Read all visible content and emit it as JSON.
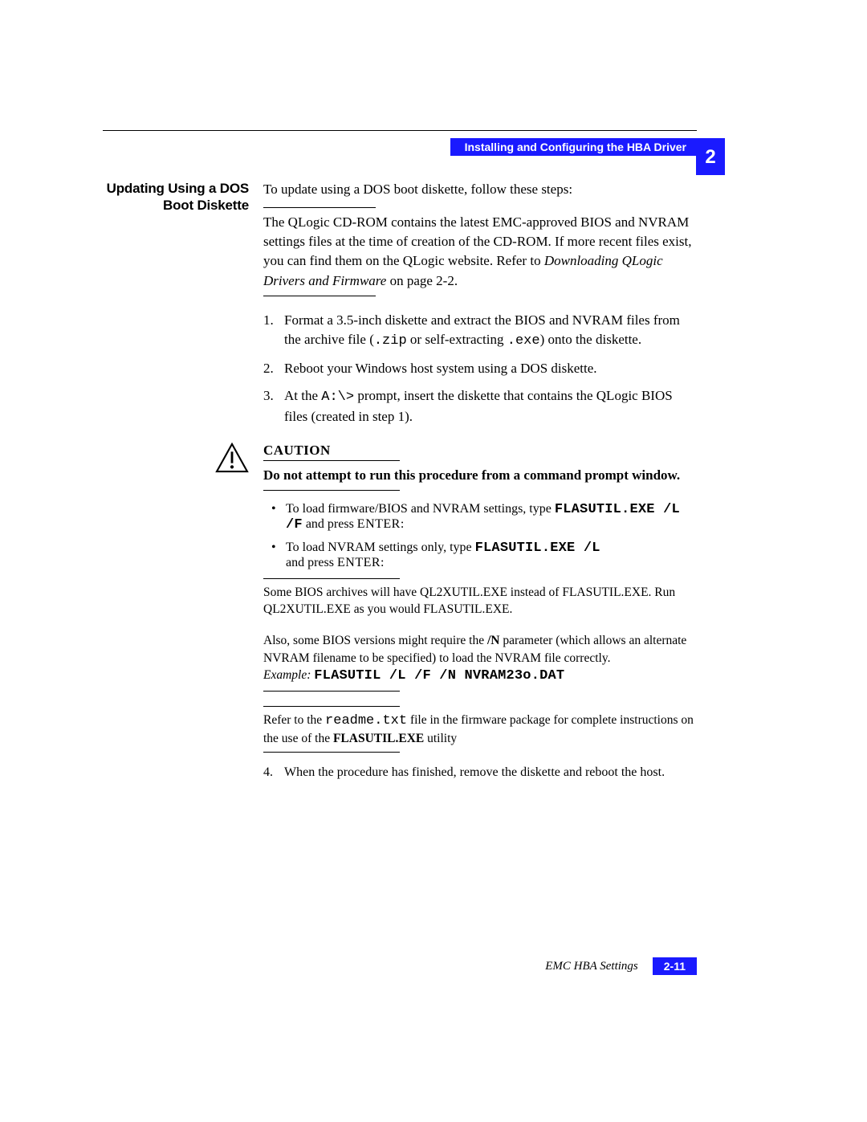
{
  "header": {
    "running_title": "Installing and Configuring the HBA Driver",
    "chapter_number": "2"
  },
  "section": {
    "side_heading": "Updating Using a DOS Boot Diskette",
    "intro": "To update using a DOS boot diskette, follow these steps:",
    "note1_part1": "The QLogic CD-ROM contains the latest EMC-approved BIOS and NVRAM settings files at the time of creation of the CD-ROM. If more recent files exist, you can find them on the QLogic website. Refer to ",
    "note1_italic": "Downloading QLogic Drivers and Firmware",
    "note1_part2": " on page 2-2.",
    "steps": {
      "s1_a": "Format a 3.5-inch diskette and extract the BIOS and NVRAM files from the archive file (",
      "s1_zip": ".zip",
      "s1_b": " or self-extracting ",
      "s1_exe": ".exe",
      "s1_c": ") onto the diskette.",
      "s2": "Reboot your Windows host system using a DOS diskette.",
      "s3_a": "At the ",
      "s3_prompt": "A:\\>",
      "s3_b": " prompt, insert the diskette that contains the QLogic BIOS files (created in step 1).",
      "s4": "When the procedure has finished, remove the diskette and reboot the host."
    },
    "caution": {
      "title": "CAUTION",
      "text": "Do not attempt to run this procedure from a command prompt window."
    },
    "bullets": {
      "b1_a": "To load firmware/BIOS and NVRAM settings, type ",
      "b1_cmd": "FLASUTIL.EXE /L /F",
      "b1_b": " and press ",
      "enter": "ENTER",
      "colon": ":",
      "b2_a": "To load NVRAM settings only, type ",
      "b2_cmd": "FLASUTIL.EXE /L",
      "b2_b": " and press "
    },
    "note2": "Some BIOS archives will have QL2XUTIL.EXE instead of FLASUTIL.EXE. Run QL2XUTIL.EXE as you would FLASUTIL.EXE.",
    "note3_a": "Also, some BIOS versions might require the ",
    "note3_n": "/N",
    "note3_b": " parameter (which allows an alternate NVRAM filename to be specified) to load the NVRAM file correctly.",
    "example_label": "Example: ",
    "example_cmd": "FLASUTIL /L /F /N NVRAM23o.DAT",
    "note4_a": "Refer to the ",
    "note4_file": "readme.txt",
    "note4_b": " file in the firmware package for complete instructions on the use of the ",
    "note4_bold": "FLASUTIL.EXE",
    "note4_c": " utility"
  },
  "footer": {
    "title": "EMC HBA Settings",
    "page": "2-11"
  }
}
